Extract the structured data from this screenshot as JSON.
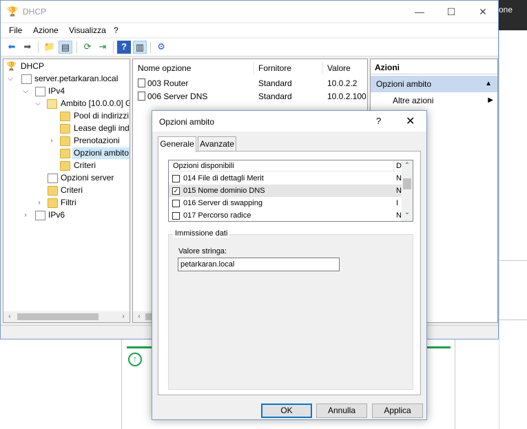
{
  "background": {
    "corner_text": "one"
  },
  "window": {
    "title": "DHCP",
    "minimize": "—",
    "maximize": "☐",
    "close": "✕"
  },
  "menu": [
    "File",
    "Azione",
    "Visualizza",
    "?"
  ],
  "tree": {
    "items": [
      {
        "label": "DHCP",
        "icon": "dhcp-icon"
      },
      {
        "label": "server.petarkaran.local",
        "icon": "server-icon"
      },
      {
        "label": "IPv4",
        "icon": "ipv4-icon"
      },
      {
        "label": "Ambito [10.0.0.0] G",
        "icon": "folder-icon"
      },
      {
        "label": "Pool di indirizzi",
        "icon": "folder-icon"
      },
      {
        "label": "Lease degli indi",
        "icon": "lease-icon"
      },
      {
        "label": "Prenotazioni",
        "icon": "folder-icon"
      },
      {
        "label": "Opzioni ambito",
        "icon": "folder-icon"
      },
      {
        "label": "Criteri",
        "icon": "folder-icon"
      },
      {
        "label": "Opzioni server",
        "icon": "page-icon"
      },
      {
        "label": "Criteri",
        "icon": "folder-icon"
      },
      {
        "label": "Filtri",
        "icon": "filter-icon"
      },
      {
        "label": "IPv6",
        "icon": "ipv6-icon"
      }
    ]
  },
  "list": {
    "columns": [
      "Nome opzione",
      "Fornitore",
      "Valore"
    ],
    "rows": [
      {
        "name": "003 Router",
        "vendor": "Standard",
        "value": "10.0.2.2"
      },
      {
        "name": "006 Server DNS",
        "vendor": "Standard",
        "value": "10.0.2.100"
      }
    ]
  },
  "actions": {
    "header": "Azioni",
    "section": "Opzioni ambito",
    "item": "Altre azioni"
  },
  "dialog": {
    "title": "Opzioni ambito",
    "help": "?",
    "close": "✕",
    "tabs": [
      "Generale",
      "Avanzate"
    ],
    "options_header": "Opzioni disponibili",
    "options_header_trail": "D",
    "options": [
      {
        "label": "014 File di dettagli Merit",
        "checked": false,
        "trail": "N"
      },
      {
        "label": "015 Nome dominio DNS",
        "checked": true,
        "trail": "N"
      },
      {
        "label": "016 Server di swapping",
        "checked": false,
        "trail": "I"
      },
      {
        "label": "017 Percorso radice",
        "checked": false,
        "trail": "N"
      }
    ],
    "group_label": "Immissione dati",
    "value_label": "Valore stringa:",
    "value": "petarkaran.local",
    "buttons": {
      "ok": "OK",
      "cancel": "Annulla",
      "apply": "Applica"
    }
  }
}
